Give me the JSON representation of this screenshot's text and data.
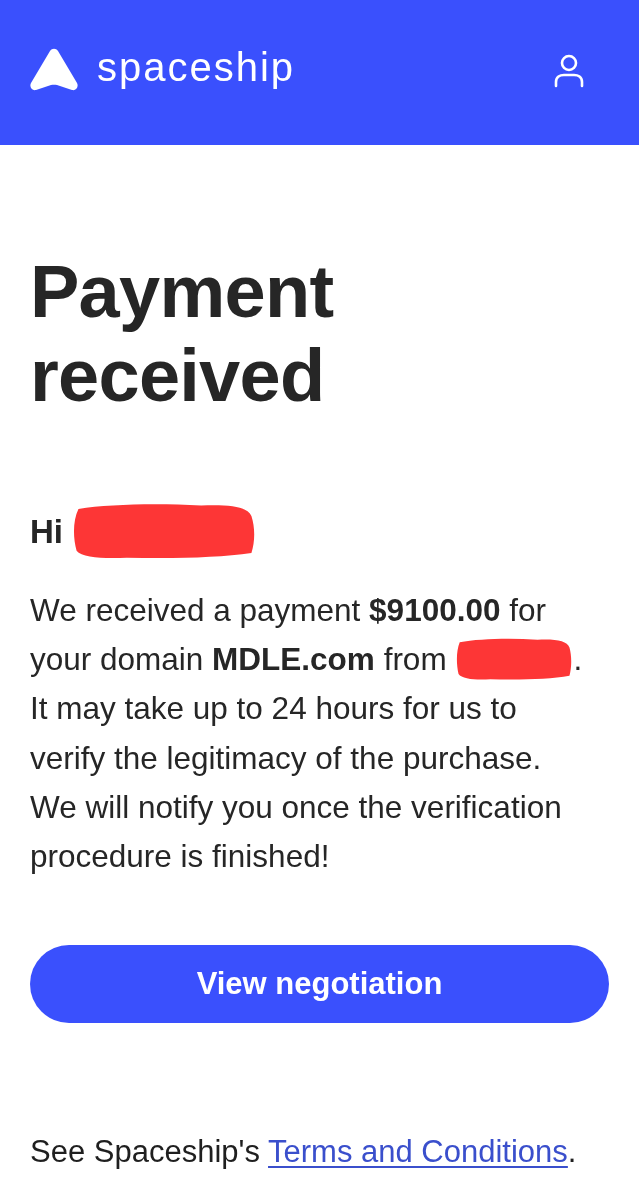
{
  "header": {
    "brand": "spaceship"
  },
  "title": "Payment received",
  "greeting": {
    "text": "Hi",
    "name_redacted": true
  },
  "message": {
    "lines": [
      {
        "text": "We received a payment **$9100.00** for",
        "redacted": false
      },
      {
        "text": "your domain **MDLE.com** from",
        "redacted": true,
        "after": "."
      },
      {
        "text": "It may take up to 24 hours for us to",
        "redacted": false
      },
      {
        "text": "verify the legitimacy of the purchase.",
        "redacted": false
      },
      {
        "text": "We will notify you once the verification",
        "redacted": false
      },
      {
        "text": "procedure is finished!",
        "redacted": false
      }
    ]
  },
  "button": {
    "label": "View negotiation"
  },
  "footer": {
    "text": "See Spaceship's",
    "link": "Terms and Conditions",
    "end": "."
  }
}
